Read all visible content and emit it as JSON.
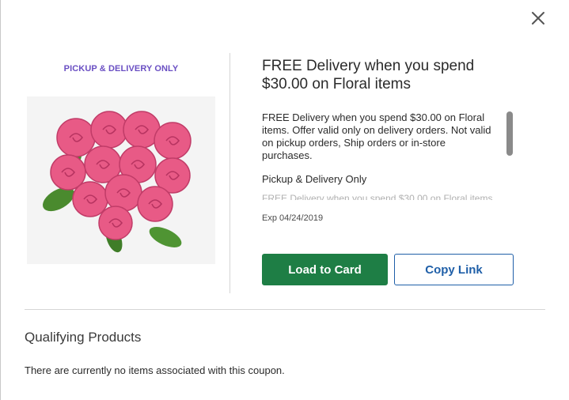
{
  "modal": {
    "close_icon": "close-icon",
    "badge": "PICKUP & DELIVERY ONLY",
    "image_alt": "pink-roses-heart-bouquet",
    "title": "FREE Delivery when you spend $30.00 on Floral items",
    "description": "FREE Delivery when you spend $30.00 on Floral items. Offer valid only on delivery orders. Not valid on pickup orders, Ship orders or in-store purchases.",
    "restriction": "Pickup & Delivery Only",
    "expiry": "Exp 04/24/2019",
    "load_button": "Load to Card",
    "copy_button": "Copy Link"
  },
  "qualifying": {
    "title": "Qualifying Products",
    "empty_message": "There are currently no items associated with this coupon."
  },
  "colors": {
    "badge": "#6a4fc3",
    "primary_button": "#1e7e45",
    "link_button": "#1f5fa8"
  }
}
